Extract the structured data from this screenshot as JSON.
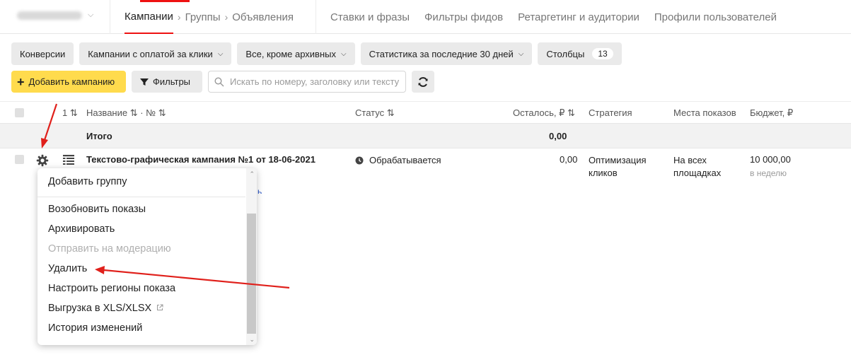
{
  "header": {
    "account_blurred": "",
    "crumbs": [
      "Кампании",
      "Группы",
      "Объявления"
    ],
    "links": [
      "Ставки и фразы",
      "Фильтры фидов",
      "Ретаргетинг и аудитории",
      "Профили пользователей"
    ]
  },
  "filters": {
    "chips": [
      "Конверсии",
      "Кампании с оплатой за клики",
      "Все, кроме архивных",
      "Статистика за последние 30 дней"
    ],
    "columns_label": "Столбцы",
    "columns_count": "13"
  },
  "actions": {
    "add_campaign": "Добавить кампанию",
    "filters": "Фильтры",
    "search_placeholder": "Искать по номеру, заголовку или тексту"
  },
  "table": {
    "headers": {
      "id_sort": "1",
      "name": "Название",
      "dot": "·",
      "number": "№",
      "status": "Статус",
      "remaining": "Осталось, ₽",
      "strategy": "Стратегия",
      "places": "Места показов",
      "budget": "Бюджет, ₽"
    },
    "total": {
      "label": "Итого",
      "remaining": "0,00"
    },
    "rows": [
      {
        "name": "Текстово-графическая кампания №1 от 18-06-2021",
        "status": "Обрабатывается",
        "remaining": "0,00",
        "strategy_line1": "Оптимизация",
        "strategy_line2": "кликов",
        "places_line1": "На всех",
        "places_line2": "площадках",
        "budget": "10 000,00",
        "budget_period": "в неделю"
      }
    ]
  },
  "menu": {
    "items": [
      {
        "label": "Добавить группу",
        "enabled": true
      },
      {
        "label": "Возобновить показы",
        "enabled": true
      },
      {
        "label": "Архивировать",
        "enabled": true
      },
      {
        "label": "Отправить на модерацию",
        "enabled": false
      },
      {
        "label": "Удалить",
        "enabled": true
      },
      {
        "label": "Настроить регионы показа",
        "enabled": true
      },
      {
        "label": "Выгрузка в XLS/XLSX",
        "enabled": true
      },
      {
        "label": "История изменений",
        "enabled": true
      }
    ]
  },
  "colors": {
    "accent_red": "#e11111",
    "add_button_yellow": "#ffdb4d",
    "annotation_red": "#e0201b"
  },
  "icons": [
    "chevron-down-icon",
    "plus-icon",
    "funnel-icon",
    "search-icon",
    "refresh-icon",
    "sort-icon",
    "gear-icon",
    "list-icon",
    "clock-icon",
    "external-link-icon"
  ]
}
